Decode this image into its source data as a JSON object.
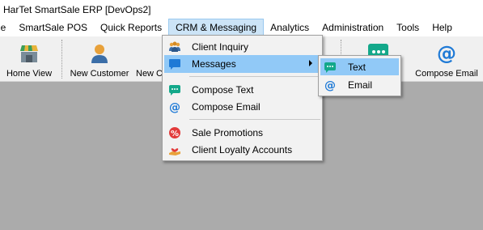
{
  "window": {
    "title": "HarTet SmartSale ERP [DevOps2]"
  },
  "menubar": {
    "items": [
      {
        "label": "le"
      },
      {
        "label": "SmartSale POS"
      },
      {
        "label": "Quick Reports"
      },
      {
        "label": "CRM & Messaging"
      },
      {
        "label": "Analytics"
      },
      {
        "label": "Administration"
      },
      {
        "label": "Tools"
      },
      {
        "label": "Help"
      }
    ]
  },
  "toolbar": {
    "home_view": "Home View",
    "new_customer": "New Customer",
    "new_c_partial": "New C",
    "text_partial": "xt",
    "compose_email": "Compose Email"
  },
  "crm_menu": {
    "client_inquiry": "Client Inquiry",
    "messages": "Messages",
    "compose_text": "Compose Text",
    "compose_email": "Compose Email",
    "sale_promotions": "Sale Promotions",
    "client_loyalty": "Client Loyalty Accounts"
  },
  "messages_submenu": {
    "text": "Text",
    "email": "Email"
  },
  "colors": {
    "highlight": "#91c9f7",
    "menu_active": "#cce4f7",
    "workspace": "#ababab",
    "toolbar": "#f0f0f0",
    "accent_blue": "#1f7ad6",
    "chat_green": "#13a88a"
  },
  "icons": {
    "home": "store-icon",
    "customer": "person-icon",
    "chat": "chat-bubble-icon",
    "email": "at-sign-icon",
    "inquiry": "group-icon",
    "promotion": "percent-badge-icon",
    "loyalty": "heart-hand-icon"
  }
}
